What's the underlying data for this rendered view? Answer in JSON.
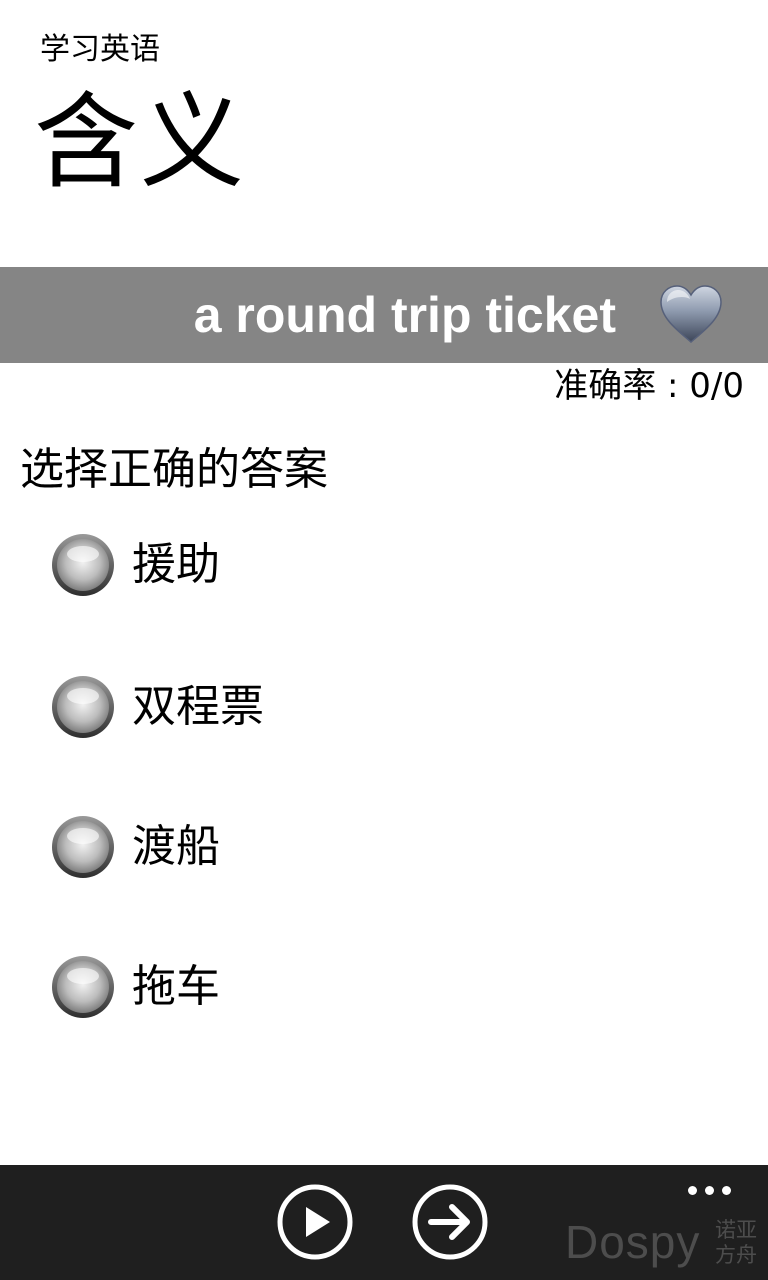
{
  "header": {
    "app_title": "学习英语",
    "page_title": "含义"
  },
  "word": {
    "text": "a round trip ticket",
    "favorite_icon": "heart-icon"
  },
  "accuracy": {
    "text": "准确率 : 0/0"
  },
  "quiz": {
    "prompt": "选择正确的答案",
    "options": [
      {
        "label": "援助",
        "icon": "radio-icon"
      },
      {
        "label": "双程票",
        "icon": "radio-icon"
      },
      {
        "label": "渡船",
        "icon": "radio-icon"
      },
      {
        "label": "拖车",
        "icon": "radio-icon"
      }
    ]
  },
  "app_bar": {
    "buttons": [
      {
        "icon": "play-icon"
      },
      {
        "icon": "arrow-right-icon"
      }
    ],
    "more_icon": "more-dots-icon"
  },
  "watermark": {
    "text": "Dospy",
    "sub_line1": "诺亚",
    "sub_line2": "方舟"
  },
  "colors": {
    "banner": "#858585",
    "app_bar": "#1f1f1f",
    "watermark": "#4d4d4d"
  }
}
